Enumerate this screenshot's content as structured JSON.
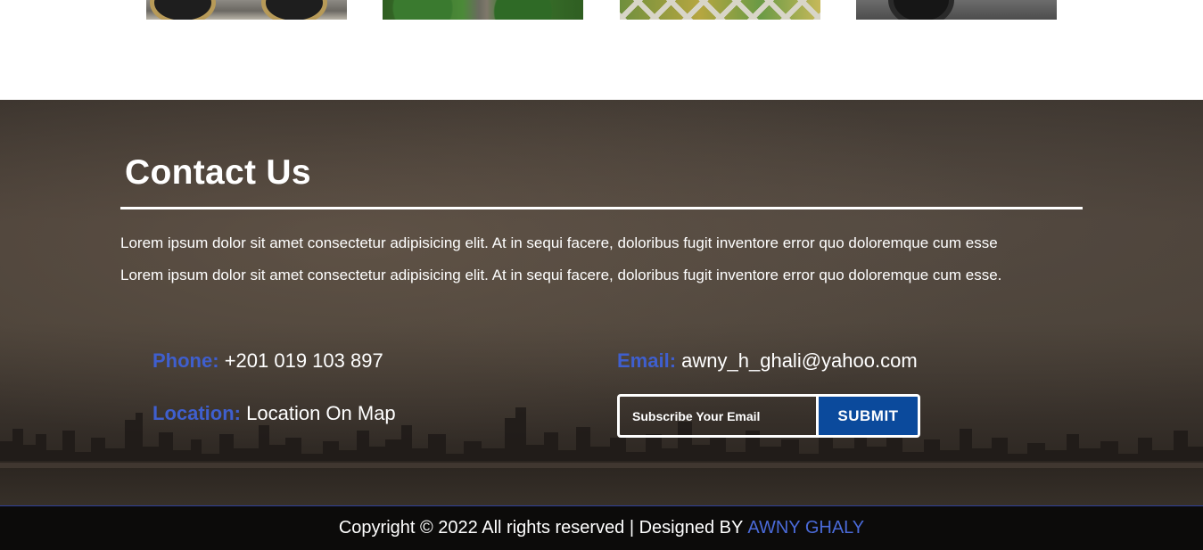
{
  "gallery": {
    "thumbnails": [
      {
        "name": "motorcycle-photo"
      },
      {
        "name": "forest-photo"
      },
      {
        "name": "garden-photo"
      },
      {
        "name": "car-photo"
      }
    ]
  },
  "contact": {
    "title": "Contact Us",
    "intro_lines": [
      "Lorem ipsum dolor sit amet consectetur adipisicing elit. At in sequi facere, doloribus fugit inventore error quo doloremque cum esse",
      "Lorem ipsum dolor sit amet consectetur adipisicing elit. At in sequi facere, doloribus fugit inventore error quo doloremque cum esse."
    ],
    "phone": {
      "label": "Phone:",
      "value": "+201 019 103 897"
    },
    "location": {
      "label": "Location:",
      "value": "Location On Map"
    },
    "email": {
      "label": "Email:",
      "value": "awny_h_ghali@yahoo.com"
    },
    "subscribe": {
      "placeholder": "Subscribe Your Email",
      "submit_label": "SUBMIT"
    }
  },
  "footer": {
    "copyright": "Copyright © 2022 All rights reserved | Designed BY",
    "author": "AWNY GHALY"
  },
  "colors": {
    "label_accent": "#3f5fce",
    "submit_button": "#0b4a9c",
    "author_link": "#4a6ad8"
  }
}
